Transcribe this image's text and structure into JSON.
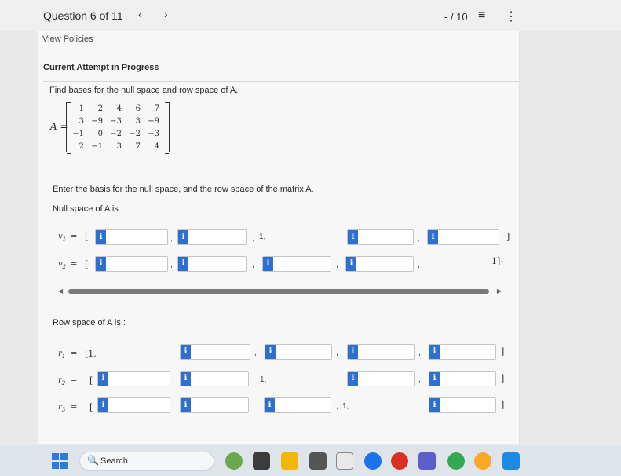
{
  "header": {
    "question_title": "Question 6 of 11",
    "prev_glyph": "‹",
    "next_glyph": "›",
    "score": "- / 10",
    "list_icon": "≡",
    "more_icon": "⋮"
  },
  "links": {
    "view_policies": "View Policies"
  },
  "attempt_status": "Current Attempt in Progress",
  "prompt": "Find bases for the null space and row space of A.",
  "matrix": {
    "label": "A =",
    "rows": [
      [
        "1",
        "2",
        "4",
        "6",
        "7"
      ],
      [
        "3",
        "−9",
        "−3",
        "3",
        "−9"
      ],
      [
        "−1",
        "0",
        "−2",
        "−2",
        "−3"
      ],
      [
        "2",
        "−1",
        "3",
        "7",
        "4"
      ]
    ]
  },
  "instruction": "Enter the basis for the null space, and the row space of the matrix A.",
  "null_space": {
    "label": "Null space of A is :",
    "v1": {
      "name": "v",
      "sub": "1",
      "eq": "=",
      "open": "[",
      "fixed": "1,",
      "close": "]"
    },
    "v2": {
      "name": "v",
      "sub": "2",
      "eq": "=",
      "open": "[",
      "close": "1]ᵀ"
    }
  },
  "row_space": {
    "label": "Row space of A is :",
    "r1": {
      "name": "r",
      "sub": "1",
      "eq": "=",
      "open": "[1,",
      "close": "]"
    },
    "r2": {
      "name": "r",
      "sub": "2",
      "eq": "=",
      "open": "[",
      "fixed": "1,",
      "close": "]"
    },
    "r3": {
      "name": "r",
      "sub": "3",
      "eq": "=",
      "open": "[",
      "fixed": "1,",
      "close": "]"
    }
  },
  "info_glyph": "i",
  "comma": ",",
  "taskbar": {
    "search_placeholder": "Search",
    "search_glyph": "🔍"
  },
  "colors": {
    "accent": "#2f6fcf",
    "taskbar": "#dfe4ea"
  }
}
